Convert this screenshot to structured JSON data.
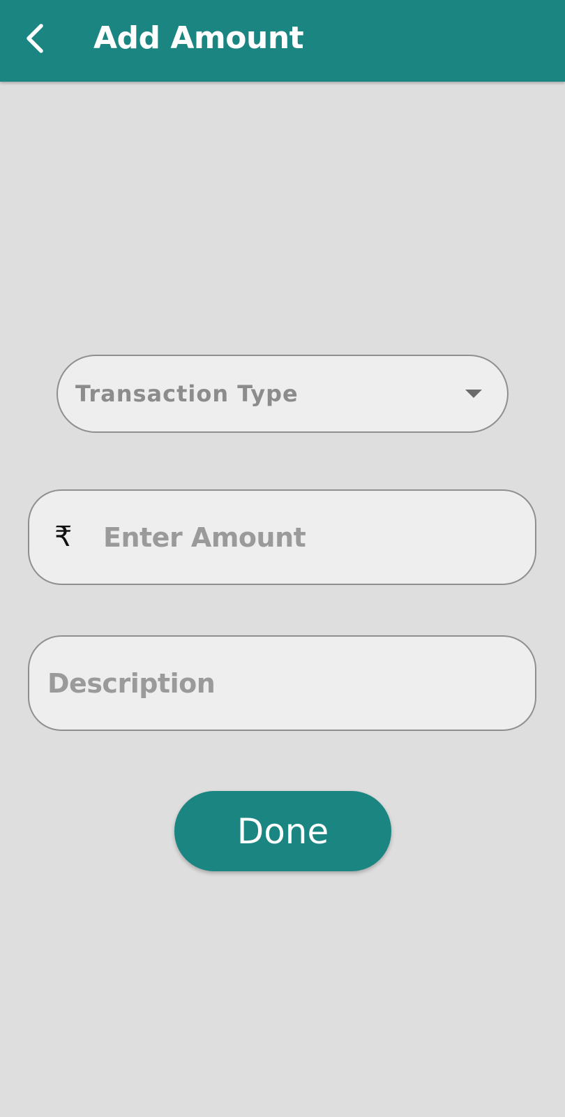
{
  "header": {
    "title": "Add Amount",
    "back_icon": "chevron-left-icon"
  },
  "form": {
    "transaction_type": {
      "placeholder": "Transaction Type",
      "icon": "caret-down-icon"
    },
    "amount": {
      "currency_symbol": "₹",
      "placeholder": "Enter Amount",
      "value": ""
    },
    "description": {
      "placeholder": "Description",
      "value": ""
    },
    "done_label": "Done"
  },
  "colors": {
    "primary": "#1b8582",
    "background": "#dedede",
    "field_background": "#eeeeee",
    "field_border": "#8f8f8f",
    "placeholder_text": "#9a9a9a"
  }
}
